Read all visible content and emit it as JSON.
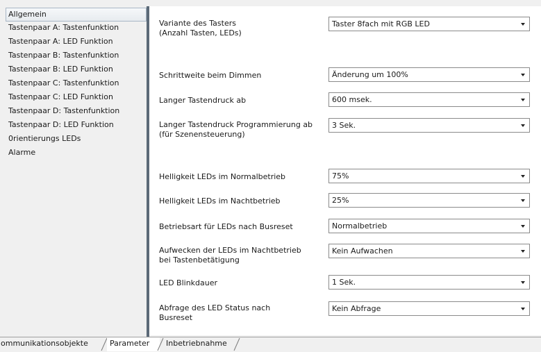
{
  "sidebar": {
    "items": [
      {
        "label": "Allgemein",
        "selected": true
      },
      {
        "label": "Tastenpaar A: Tastenfunktion"
      },
      {
        "label": "Tastenpaar A: LED Funktion"
      },
      {
        "label": "Tastenpaar B: Tastenfunktion"
      },
      {
        "label": "Tastenpaar B: LED Funktion"
      },
      {
        "label": "Tastenpaar C: Tastenfunktion"
      },
      {
        "label": "Tastenpaar C: LED Funktion"
      },
      {
        "label": "Tastenpaar D: Tastenfunktion"
      },
      {
        "label": "Tastenpaar D: LED Funktion"
      },
      {
        "label": "0rientierungs LEDs"
      },
      {
        "label": "Alarme"
      }
    ]
  },
  "params": [
    {
      "line1": "Variante des Tasters",
      "line2": "(Anzahl Tasten, LEDs)",
      "value": "Taster 8fach mit RGB LED"
    },
    {
      "line1": "Schrittweite beim Dimmen",
      "line2": "",
      "value": "Änderung um 100%"
    },
    {
      "line1": "Langer Tastendruck ab",
      "line2": "",
      "value": "600 msek."
    },
    {
      "line1": "Langer Tastendruck Programmierung ab",
      "line2": "(für Szenensteuerung)",
      "value": "3 Sek."
    },
    {
      "line1": "Helligkeit LEDs im Normalbetrieb",
      "line2": "",
      "value": "75%"
    },
    {
      "line1": "Helligkeit LEDs im Nachtbetrieb",
      "line2": "",
      "value": "25%"
    },
    {
      "line1": "Betriebsart für LEDs nach Busreset",
      "line2": "",
      "value": "Normalbetrieb"
    },
    {
      "line1": "Aufwecken der LEDs im Nachtbetrieb",
      "line2": "bei Tastenbetätigung",
      "value": "Kein Aufwachen"
    },
    {
      "line1": "LED Blinkdauer",
      "line2": "",
      "value": "1 Sek."
    },
    {
      "line1": "Abfrage des LED Status nach",
      "line2": "Busreset",
      "value": "Kein Abfrage"
    }
  ],
  "tabs": [
    {
      "label": "ommunikationsobjekte"
    },
    {
      "label": "Parameter",
      "active": true
    },
    {
      "label": "Inbetriebnahme"
    }
  ],
  "colors": {
    "splitter": "#5c6a78",
    "selected_border": "#a9b7c6",
    "content_bg": "#ffffff",
    "window_bg": "#f0f0f0"
  }
}
